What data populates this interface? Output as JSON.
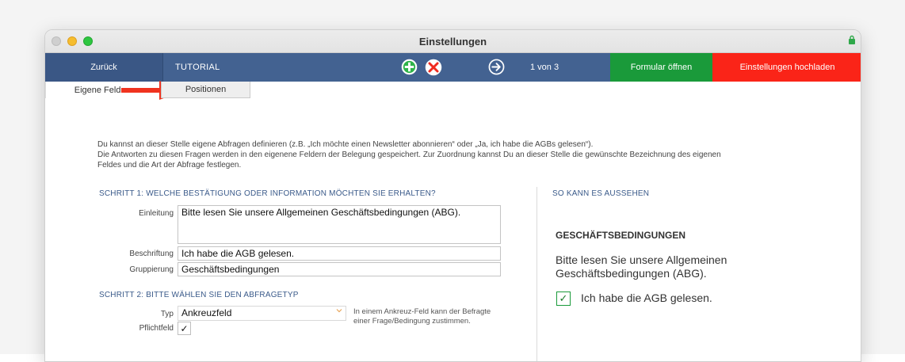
{
  "window": {
    "title": "Einstellungen"
  },
  "toolbar": {
    "back_label": "Zurück",
    "section_label": "TUTORIAL",
    "page_indicator": "1 von 3",
    "open_form_label": "Formular öffnen",
    "upload_label": "Einstellungen hochladen",
    "colors": {
      "bar": "#436291",
      "open_form": "#1a9a3a",
      "upload": "#fa2418"
    }
  },
  "tabs": [
    {
      "label": "Eigene Felder",
      "active": true
    },
    {
      "label": "Positionen",
      "active": false
    }
  ],
  "intro": {
    "line1": "Du kannst an dieser Stelle eigene Abfragen definieren (z.B. „Ich möchte einen Newsletter abonnieren“ oder „Ja, ich habe die AGBs gelesen“).",
    "line2": "Die Antworten zu diesen Fragen werden in den eigenene Feldern der Belegung gespeichert. Zur Zuordnung kannst Du an dieser Stelle die gewünschte Bezeichnung des eigenen",
    "line3": "Feldes und die Art der Abfrage festlegen."
  },
  "step1": {
    "heading": "SCHRITT 1: WELCHE BESTÄTIGUNG ODER INFORMATION MÖCHTEN SIE ERHALTEN?",
    "einleitung_label": "Einleitung",
    "einleitung_value": "Bitte lesen Sie unsere Allgemeinen Geschäftsbedingungen (ABG).",
    "beschriftung_label": "Beschriftung",
    "beschriftung_value": "Ich habe die AGB gelesen.",
    "gruppierung_label": "Gruppierung",
    "gruppierung_value": "Geschäftsbedingungen"
  },
  "step2": {
    "heading": "SCHRITT 2: BITTE WÄHLEN SIE DEN ABFRAGETYP",
    "typ_label": "Typ",
    "typ_value": "Ankreuzfeld",
    "pflicht_label": "Pflichtfeld",
    "pflicht_checked": "✓",
    "help_text": "In einem Ankreuz-Feld kann der Befragte einer Frage/Bedingung zustimmen."
  },
  "preview": {
    "heading": "SO KANN ES AUSSEHEN",
    "title": "GESCHÄFTSBEDINGUNGEN",
    "text": "Bitte lesen Sie unsere Allgemeinen Geschäftsbedingungen (ABG).",
    "checkbox_mark": "✓",
    "checkbox_label": "Ich habe die AGB gelesen."
  },
  "icons": {
    "add": "plus-circle-icon",
    "delete": "x-circle-icon",
    "next": "arrow-right-circle-icon",
    "lock": "lock-icon",
    "annotation": "red-arrow-icon"
  }
}
